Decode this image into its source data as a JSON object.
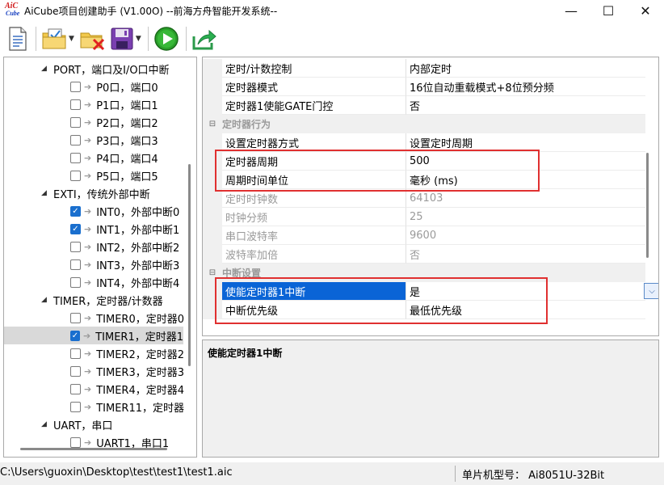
{
  "window": {
    "title": "AiCube项目创建助手 (V1.00O) --前海方舟智能开发系统--",
    "logo_top": "AiC",
    "logo_bottom": "Cube",
    "minimize": "—",
    "maximize": "☐",
    "close": "✕"
  },
  "toolbar": {
    "items": [
      "new-document-icon",
      "open-project-icon",
      "delete-project-icon",
      "save-icon",
      "run-icon",
      "export-icon"
    ],
    "dropdown_arrow": "▼"
  },
  "tree": {
    "expand_glyph": "◢",
    "arrow_glyph": "➔",
    "check_glyph": "✓",
    "groups": [
      {
        "label": "PORT，端口及I/O口中断",
        "children": [
          {
            "label": "P0口，端口0",
            "checked": false
          },
          {
            "label": "P1口，端口1",
            "checked": false
          },
          {
            "label": "P2口，端口2",
            "checked": false
          },
          {
            "label": "P3口，端口3",
            "checked": false
          },
          {
            "label": "P4口，端口4",
            "checked": false
          },
          {
            "label": "P5口，端口5",
            "checked": false
          }
        ]
      },
      {
        "label": "EXTI，传统外部中断",
        "children": [
          {
            "label": "INT0，外部中断0",
            "checked": true
          },
          {
            "label": "INT1，外部中断1",
            "checked": true
          },
          {
            "label": "INT2，外部中断2",
            "checked": false
          },
          {
            "label": "INT3，外部中断3",
            "checked": false
          },
          {
            "label": "INT4，外部中断4",
            "checked": false
          }
        ]
      },
      {
        "label": "TIMER，定时器/计数器",
        "children": [
          {
            "label": "TIMER0，定时器0",
            "checked": false
          },
          {
            "label": "TIMER1，定时器1",
            "checked": true,
            "selected": true
          },
          {
            "label": "TIMER2，定时器2",
            "checked": false
          },
          {
            "label": "TIMER3，定时器3",
            "checked": false
          },
          {
            "label": "TIMER4，定时器4",
            "checked": false
          },
          {
            "label": "TIMER11，定时器",
            "checked": false
          }
        ]
      },
      {
        "label": "UART，串口",
        "children": [
          {
            "label": "UART1，串口1",
            "checked": false
          }
        ]
      }
    ]
  },
  "properties": {
    "collapse_glyph": "⊟",
    "dropdown_glyph": "⌵",
    "rows_top": [
      {
        "name": "定时/计数控制",
        "value": "内部定时"
      },
      {
        "name": "定时器模式",
        "value": "16位自动重载模式+8位预分频"
      },
      {
        "name": "定时器1使能GATE门控",
        "value": "否"
      }
    ],
    "cat_behavior": "定时器行为",
    "rows_behavior": [
      {
        "name": "设置定时器方式",
        "value": "设置定时周期"
      },
      {
        "name": "定时器周期",
        "value": "500"
      },
      {
        "name": "周期时间单位",
        "value": "毫秒 (ms)"
      },
      {
        "name": "定时时钟数",
        "value": "64103",
        "disabled": true
      },
      {
        "name": "时钟分频",
        "value": "25",
        "disabled": true
      },
      {
        "name": "串口波特率",
        "value": "9600",
        "disabled": true
      },
      {
        "name": "波特率加倍",
        "value": "否",
        "disabled": true
      }
    ],
    "cat_interrupt": "中断设置",
    "rows_interrupt": [
      {
        "name": "使能定时器1中断",
        "value": "是",
        "selected": true
      },
      {
        "name": "中断优先级",
        "value": "最低优先级"
      }
    ]
  },
  "description": {
    "title": "使能定时器1中断"
  },
  "status": {
    "path": "C:\\Users\\guoxin\\Desktop\\test\\test1\\test1.aic",
    "model": "单片机型号：  Ai8051U-32Bit"
  }
}
